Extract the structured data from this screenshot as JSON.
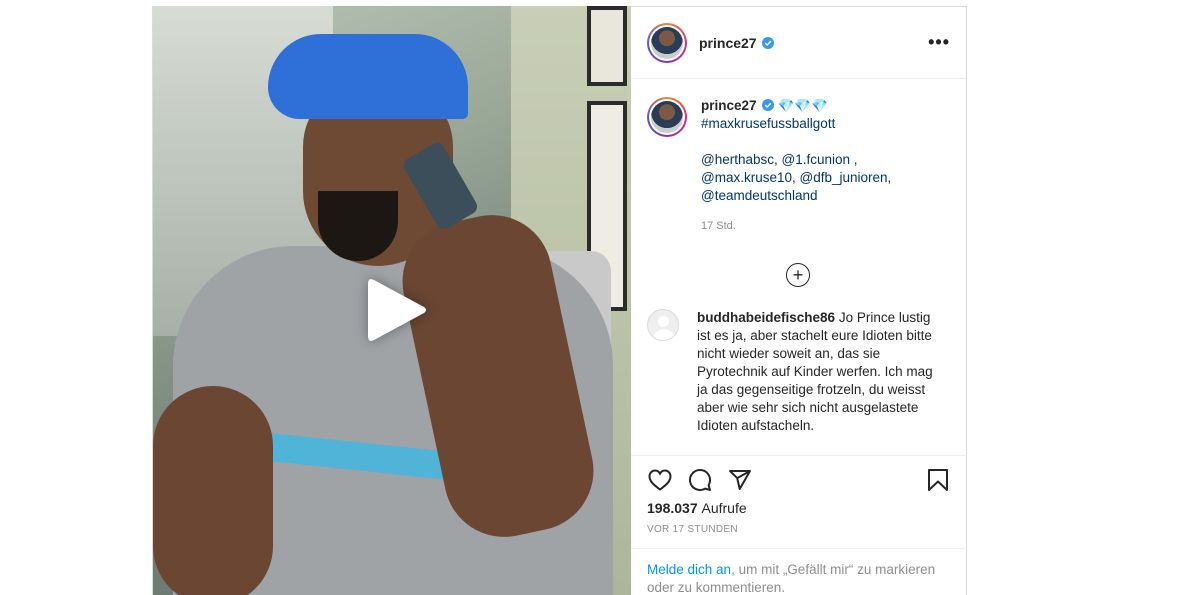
{
  "post": {
    "author": {
      "username": "prince27",
      "verified": true
    },
    "caption": {
      "emoji": "💎💎💎",
      "hashtag": "#maxkrusefussballgott",
      "mentions_line1_a": "@herthabsc",
      "mentions_line1_b": "@1.fcunion",
      "mentions_line2_a": "@max.kruse10",
      "mentions_line2_b": "@dfb_junioren",
      "mentions_line3": "@teamdeutschland",
      "time": "17 Std."
    },
    "comment": {
      "username": "buddhabeidefische86",
      "text": "Jo Prince lustig ist es ja, aber stachelt eure Idioten bitte nicht wieder soweit an, das sie Pyrotechnik auf Kinder werfen. Ich mag ja das gegenseitige frotzeln, du weisst aber wie sehr sich nicht ausgelastete Idioten aufstacheln."
    },
    "views_count": "198.037",
    "views_label": "Aufrufe",
    "posted_ago": "VOR 17 STUNDEN",
    "login_link": "Melde dich an",
    "login_text": ", um mit „Gefällt mir“ zu markieren oder zu kommentieren."
  },
  "icons": {
    "more": "more-icon",
    "add": "plus-circle-icon",
    "like": "heart-icon",
    "comment": "comment-icon",
    "share": "send-icon",
    "save": "bookmark-icon",
    "play": "play-icon",
    "verified": "verified-badge-icon"
  },
  "colors": {
    "link": "#00376b",
    "login_link": "#0095f6",
    "verified": "#3897f0",
    "muted": "#8e8e8e"
  }
}
